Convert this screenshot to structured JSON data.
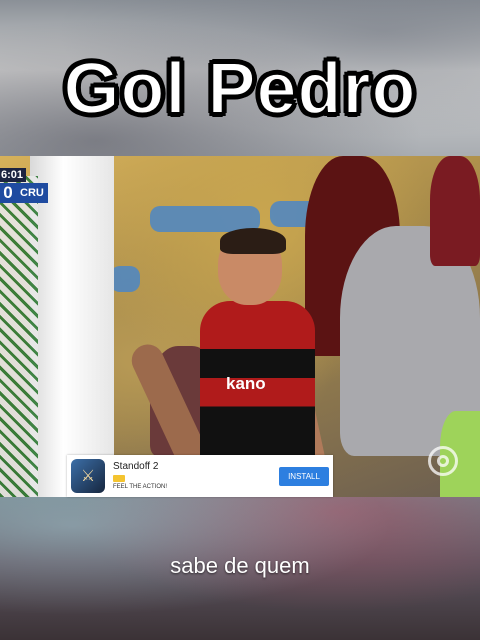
{
  "title": "Gol Pedro",
  "scoreboard": {
    "time": "6:01",
    "score": "0",
    "team": "CRU"
  },
  "video": {
    "sponsor_text": "kano",
    "watermark_icon": "globoplay-icon"
  },
  "ad": {
    "app_name": "Standoff 2",
    "tagline": "FEEL THE ACTION!",
    "install_label": "INSTALL",
    "icon": "game-icon",
    "button_color": "#2d7fe0"
  },
  "caption": "sabe de quem"
}
